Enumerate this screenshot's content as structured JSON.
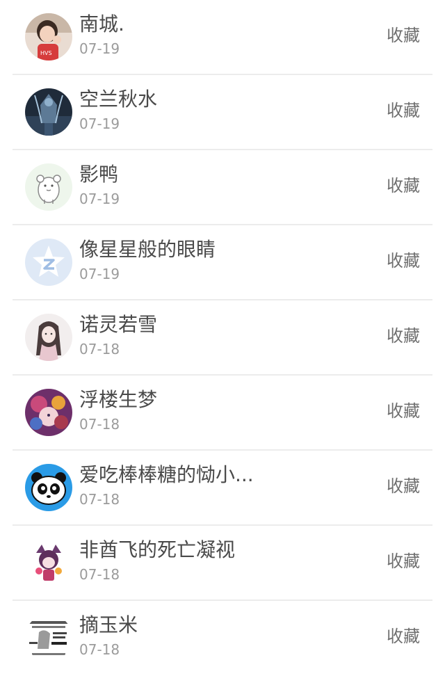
{
  "items": [
    {
      "name": "南城.",
      "date": "07-19",
      "action": "收藏",
      "avatar": "avatar-girl-photo"
    },
    {
      "name": "空兰秋水",
      "date": "07-19",
      "action": "收藏",
      "avatar": "avatar-armored-warrior"
    },
    {
      "name": "影鸭",
      "date": "07-19",
      "action": "收藏",
      "avatar": "avatar-hamster-sketch"
    },
    {
      "name": "像星星般的眼睛",
      "date": "07-19",
      "action": "收藏",
      "avatar": "avatar-qzone-star"
    },
    {
      "name": "诺灵若雪",
      "date": "07-18",
      "action": "收藏",
      "avatar": "avatar-anime-girl-sketch"
    },
    {
      "name": "浮楼生梦",
      "date": "07-18",
      "action": "收藏",
      "avatar": "avatar-anime-colorful"
    },
    {
      "name": "爱吃棒棒糖的恸小...",
      "date": "07-18",
      "action": "收藏",
      "avatar": "avatar-panda"
    },
    {
      "name": "非酋飞的死亡凝视",
      "date": "07-18",
      "action": "收藏",
      "avatar": "avatar-anime-pink"
    },
    {
      "name": "摘玉米",
      "date": "07-18",
      "action": "收藏",
      "avatar": "avatar-meme-text"
    }
  ],
  "colors": {
    "name": "#4a4a4a",
    "date": "#9b9b9b",
    "action": "#6f6f6f",
    "divider": "#ececec"
  }
}
